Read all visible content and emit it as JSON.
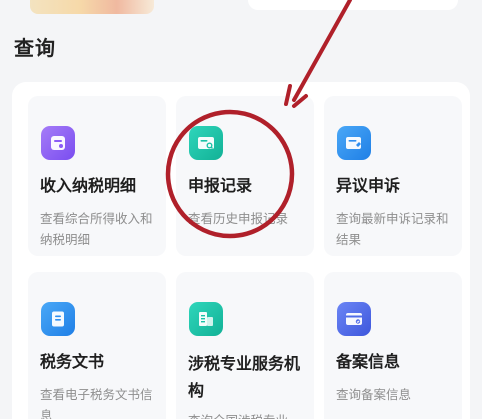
{
  "section": {
    "title": "查询"
  },
  "tiles": [
    {
      "title": "收入纳税明细",
      "desc": "查看综合所得收入和纳税明细",
      "icon": "income-tax-icon"
    },
    {
      "title": "申报记录",
      "desc": "查看历史申报记录",
      "icon": "declaration-record-icon"
    },
    {
      "title": "异议申诉",
      "desc": "查询最新申诉记录和结果",
      "icon": "appeal-icon"
    },
    {
      "title": "税务文书",
      "desc": "查看电子税务文书信息",
      "icon": "tax-document-icon"
    },
    {
      "title": "涉税专业服务机构",
      "desc": "查询全国涉税专业",
      "icon": "tax-agency-icon"
    },
    {
      "title": "备案信息",
      "desc": "查询备案信息",
      "icon": "filing-info-icon"
    }
  ],
  "colors": {
    "purple": "#8b5cf6",
    "teal": "#19c2a6",
    "blue": "#2e8ef0",
    "indigo": "#4f6be8",
    "annotation_red": "#b0202a"
  }
}
